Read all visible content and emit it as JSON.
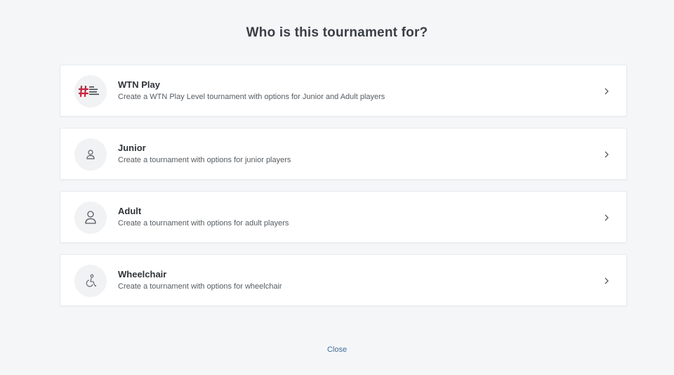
{
  "modal": {
    "title": "Who is this tournament for?",
    "close_label": "Close"
  },
  "options": [
    {
      "title": "WTN Play",
      "description": "Create a WTN Play Level tournament with options for Junior and Adult players",
      "icon": "wtn-logo-icon"
    },
    {
      "title": "Junior",
      "description": "Create a tournament with options for junior players",
      "icon": "person-small-icon"
    },
    {
      "title": "Adult",
      "description": "Create a tournament with options for adult players",
      "icon": "person-icon"
    },
    {
      "title": "Wheelchair",
      "description": "Create a tournament with options for wheelchair",
      "icon": "wheelchair-icon"
    }
  ],
  "colors": {
    "background": "#f5f6f8",
    "link": "#3e6fa3",
    "wtn_brand": "#c8243e"
  }
}
